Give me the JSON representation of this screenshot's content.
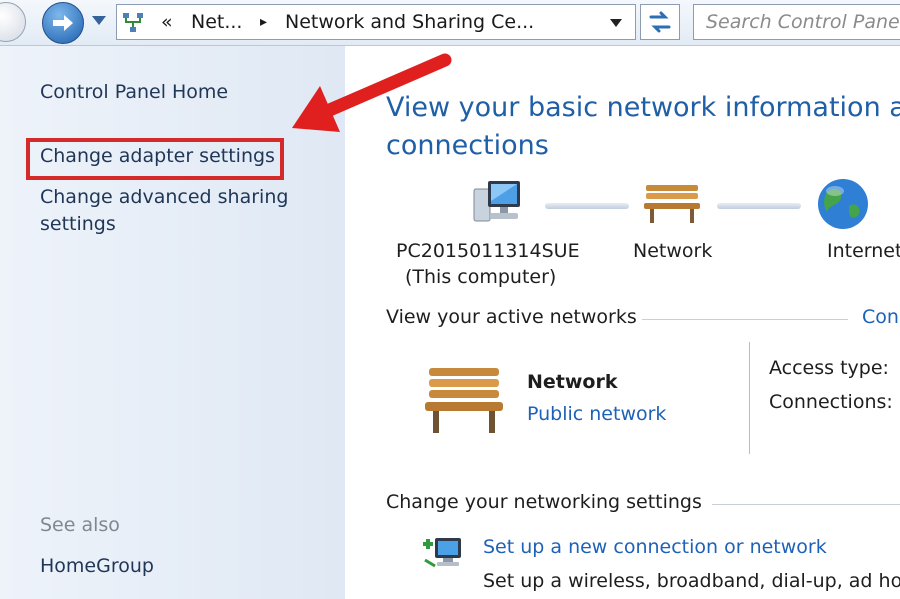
{
  "toolbar": {
    "address": {
      "overflow": "«",
      "crumb1": "Net...",
      "separator": "▸",
      "crumb2": "Network and Sharing Ce..."
    },
    "search_placeholder": "Search Control Panel"
  },
  "sidebar": {
    "home": "Control Panel Home",
    "adapter": "Change adapter settings",
    "advanced_line1": "Change advanced sharing",
    "advanced_line2": "settings",
    "see_also": "See also",
    "homegroup": "HomeGroup"
  },
  "main": {
    "heading_line1": "View your basic network information and",
    "heading_line2": "connections",
    "map": {
      "computer_name": "PC2015011314SUE",
      "computer_note": "(This computer)",
      "network": "Network",
      "internet": "Internet"
    },
    "active_networks": {
      "title": "View your active networks",
      "connect_link": "Con",
      "network_name": "Network",
      "network_type": "Public network",
      "access_type_label": "Access type:",
      "connections_label": "Connections:"
    },
    "change_settings": {
      "title": "Change your networking settings",
      "item1_link": "Set up a new connection or network",
      "item1_desc": "Set up a wireless, broadband, dial-up, ad hoc"
    }
  },
  "colors": {
    "annotation_red": "#d42a2a",
    "heading_blue": "#1f5fa6",
    "link_blue": "#1e62b8",
    "sidebar_bg": "#e6edf6"
  },
  "icons": [
    "back-icon",
    "forward-arrow-icon",
    "history-dropdown-icon",
    "network-folder-icon",
    "address-dropdown-icon",
    "refresh-icon",
    "computer-icon",
    "bench-icon",
    "globe-icon",
    "new-connection-icon",
    "annotation-arrow-icon"
  ]
}
